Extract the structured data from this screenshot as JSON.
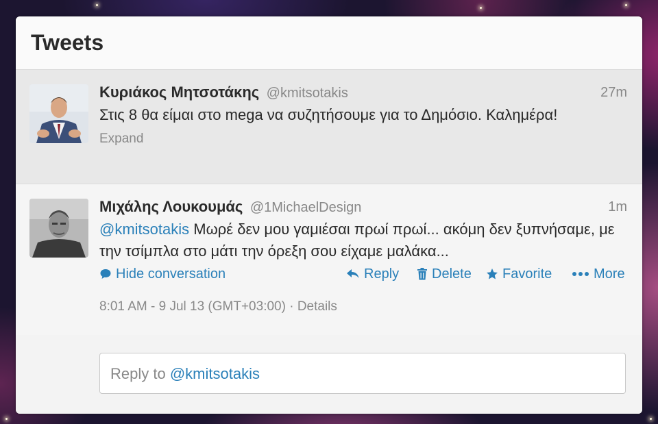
{
  "panel": {
    "title": "Tweets"
  },
  "tweets": [
    {
      "fullname": "Κυριάκος Μητσοτάκης",
      "handle": "@kmitsotakis",
      "time": "27m",
      "text": "Στις 8 θα είμαι στο mega να συζητήσουμε για το Δημόσιο. Καλημέρα!",
      "expand_label": "Expand",
      "avatar_icon": "person-in-suit-avatar"
    },
    {
      "fullname": "Μιχάλης Λουκουμάς",
      "handle": "@1MichaelDesign",
      "time": "1m",
      "mention": "@kmitsotakis",
      "text": "Μωρέ δεν μου γαμιέσαι πρωί πρωί... ακόμη δεν ξυπνήσαμε, με την τσίμπλα στο μάτι την όρεξη σου είχαμε μαλάκα...",
      "avatar_icon": "grayscale-portrait-avatar",
      "actions": {
        "hide_conversation": "Hide conversation",
        "reply": "Reply",
        "delete": "Delete",
        "favorite": "Favorite",
        "more": "More"
      },
      "timestamp": "8:01 AM - 9 Jul 13 (GMT+03:00)",
      "separator": "·",
      "details": "Details"
    }
  ],
  "reply": {
    "prefix": "Reply to",
    "mention": "@kmitsotakis"
  },
  "colors": {
    "link": "#2a80b9",
    "text": "#2a2a2a",
    "muted": "#888888",
    "selected_row": "#e8e8e8"
  }
}
